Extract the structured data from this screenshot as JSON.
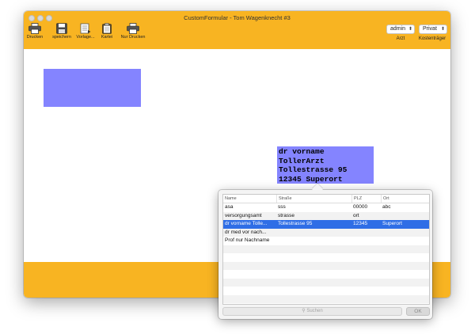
{
  "window": {
    "title": "CustomFormular -  Tom Wagenknecht #3"
  },
  "toolbar": {
    "items": [
      {
        "label": "Drucken",
        "icon": "printer-icon"
      },
      {
        "label": "speichern",
        "icon": "save-disk-icon"
      },
      {
        "label": "Vorlage...",
        "icon": "template-icon"
      },
      {
        "label": "Kartei",
        "icon": "clipboard-icon"
      },
      {
        "label": "Nur Drucken",
        "icon": "printer-icon"
      }
    ],
    "arzt": {
      "value": "admin",
      "label": "Arzt"
    },
    "kostentraeger": {
      "value": "Privat",
      "label": "Kostenträger"
    }
  },
  "address_block": {
    "line1": "dr vorname",
    "line2": "TollerArzt",
    "line3": "Tollestrasse 95",
    "line4": "12345 Superort"
  },
  "popup": {
    "columns": [
      "Name",
      "Straße",
      "PLZ",
      "Ort"
    ],
    "rows": [
      {
        "name": "asa",
        "strasse": "sss",
        "plz": "00000",
        "ort": "abc",
        "selected": false
      },
      {
        "name": "versorgungsamt",
        "strasse": "strasse",
        "plz": "ort",
        "ort": "",
        "selected": false
      },
      {
        "name": "dr vorname Tolle...",
        "strasse": "Tollestrasse 95",
        "plz": "12345",
        "ort": "Superort",
        "selected": true
      },
      {
        "name": "dr med vor nach...",
        "strasse": "",
        "plz": "",
        "ort": "",
        "selected": false
      },
      {
        "name": "Prof nur Nachname",
        "strasse": "",
        "plz": "",
        "ort": "",
        "selected": false
      }
    ],
    "search_placeholder": "Suchen",
    "ok_label": "OK"
  },
  "colors": {
    "toolbar": "#f8b422",
    "field_box": "#8484ff",
    "selection": "#2f6ee6"
  }
}
